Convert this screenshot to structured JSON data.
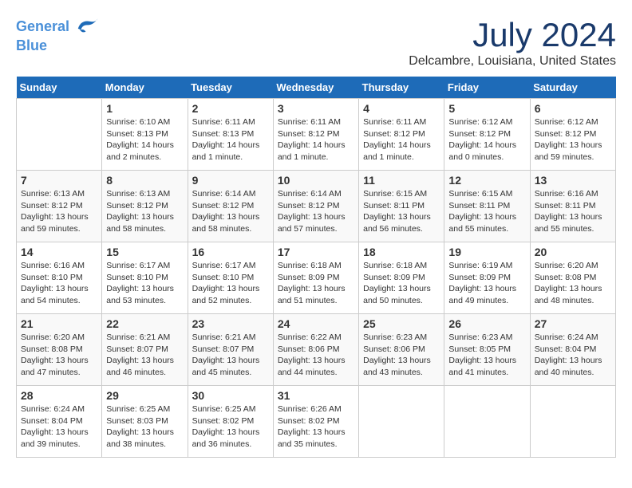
{
  "header": {
    "logo_line1": "General",
    "logo_line2": "Blue",
    "month_title": "July 2024",
    "location": "Delcambre, Louisiana, United States"
  },
  "days_of_week": [
    "Sunday",
    "Monday",
    "Tuesday",
    "Wednesday",
    "Thursday",
    "Friday",
    "Saturday"
  ],
  "weeks": [
    [
      {
        "day": "",
        "info": ""
      },
      {
        "day": "1",
        "info": "Sunrise: 6:10 AM\nSunset: 8:13 PM\nDaylight: 14 hours\nand 2 minutes."
      },
      {
        "day": "2",
        "info": "Sunrise: 6:11 AM\nSunset: 8:13 PM\nDaylight: 14 hours\nand 1 minute."
      },
      {
        "day": "3",
        "info": "Sunrise: 6:11 AM\nSunset: 8:12 PM\nDaylight: 14 hours\nand 1 minute."
      },
      {
        "day": "4",
        "info": "Sunrise: 6:11 AM\nSunset: 8:12 PM\nDaylight: 14 hours\nand 1 minute."
      },
      {
        "day": "5",
        "info": "Sunrise: 6:12 AM\nSunset: 8:12 PM\nDaylight: 14 hours\nand 0 minutes."
      },
      {
        "day": "6",
        "info": "Sunrise: 6:12 AM\nSunset: 8:12 PM\nDaylight: 13 hours\nand 59 minutes."
      }
    ],
    [
      {
        "day": "7",
        "info": "Sunrise: 6:13 AM\nSunset: 8:12 PM\nDaylight: 13 hours\nand 59 minutes."
      },
      {
        "day": "8",
        "info": "Sunrise: 6:13 AM\nSunset: 8:12 PM\nDaylight: 13 hours\nand 58 minutes."
      },
      {
        "day": "9",
        "info": "Sunrise: 6:14 AM\nSunset: 8:12 PM\nDaylight: 13 hours\nand 58 minutes."
      },
      {
        "day": "10",
        "info": "Sunrise: 6:14 AM\nSunset: 8:12 PM\nDaylight: 13 hours\nand 57 minutes."
      },
      {
        "day": "11",
        "info": "Sunrise: 6:15 AM\nSunset: 8:11 PM\nDaylight: 13 hours\nand 56 minutes."
      },
      {
        "day": "12",
        "info": "Sunrise: 6:15 AM\nSunset: 8:11 PM\nDaylight: 13 hours\nand 55 minutes."
      },
      {
        "day": "13",
        "info": "Sunrise: 6:16 AM\nSunset: 8:11 PM\nDaylight: 13 hours\nand 55 minutes."
      }
    ],
    [
      {
        "day": "14",
        "info": "Sunrise: 6:16 AM\nSunset: 8:10 PM\nDaylight: 13 hours\nand 54 minutes."
      },
      {
        "day": "15",
        "info": "Sunrise: 6:17 AM\nSunset: 8:10 PM\nDaylight: 13 hours\nand 53 minutes."
      },
      {
        "day": "16",
        "info": "Sunrise: 6:17 AM\nSunset: 8:10 PM\nDaylight: 13 hours\nand 52 minutes."
      },
      {
        "day": "17",
        "info": "Sunrise: 6:18 AM\nSunset: 8:09 PM\nDaylight: 13 hours\nand 51 minutes."
      },
      {
        "day": "18",
        "info": "Sunrise: 6:18 AM\nSunset: 8:09 PM\nDaylight: 13 hours\nand 50 minutes."
      },
      {
        "day": "19",
        "info": "Sunrise: 6:19 AM\nSunset: 8:09 PM\nDaylight: 13 hours\nand 49 minutes."
      },
      {
        "day": "20",
        "info": "Sunrise: 6:20 AM\nSunset: 8:08 PM\nDaylight: 13 hours\nand 48 minutes."
      }
    ],
    [
      {
        "day": "21",
        "info": "Sunrise: 6:20 AM\nSunset: 8:08 PM\nDaylight: 13 hours\nand 47 minutes."
      },
      {
        "day": "22",
        "info": "Sunrise: 6:21 AM\nSunset: 8:07 PM\nDaylight: 13 hours\nand 46 minutes."
      },
      {
        "day": "23",
        "info": "Sunrise: 6:21 AM\nSunset: 8:07 PM\nDaylight: 13 hours\nand 45 minutes."
      },
      {
        "day": "24",
        "info": "Sunrise: 6:22 AM\nSunset: 8:06 PM\nDaylight: 13 hours\nand 44 minutes."
      },
      {
        "day": "25",
        "info": "Sunrise: 6:23 AM\nSunset: 8:06 PM\nDaylight: 13 hours\nand 43 minutes."
      },
      {
        "day": "26",
        "info": "Sunrise: 6:23 AM\nSunset: 8:05 PM\nDaylight: 13 hours\nand 41 minutes."
      },
      {
        "day": "27",
        "info": "Sunrise: 6:24 AM\nSunset: 8:04 PM\nDaylight: 13 hours\nand 40 minutes."
      }
    ],
    [
      {
        "day": "28",
        "info": "Sunrise: 6:24 AM\nSunset: 8:04 PM\nDaylight: 13 hours\nand 39 minutes."
      },
      {
        "day": "29",
        "info": "Sunrise: 6:25 AM\nSunset: 8:03 PM\nDaylight: 13 hours\nand 38 minutes."
      },
      {
        "day": "30",
        "info": "Sunrise: 6:25 AM\nSunset: 8:02 PM\nDaylight: 13 hours\nand 36 minutes."
      },
      {
        "day": "31",
        "info": "Sunrise: 6:26 AM\nSunset: 8:02 PM\nDaylight: 13 hours\nand 35 minutes."
      },
      {
        "day": "",
        "info": ""
      },
      {
        "day": "",
        "info": ""
      },
      {
        "day": "",
        "info": ""
      }
    ]
  ]
}
